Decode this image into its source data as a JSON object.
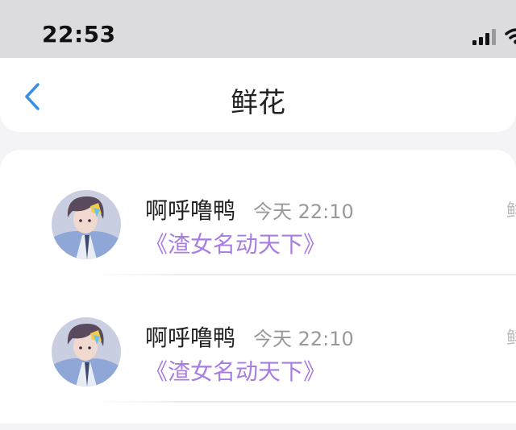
{
  "status_bar": {
    "time": "22:53",
    "signal_icon": "signal-bars-icon",
    "wifi_icon": "wifi-icon"
  },
  "nav": {
    "title": "鲜花",
    "back_icon": "chevron-left-icon",
    "accent_color": "#3a8ee6"
  },
  "messages": [
    {
      "user": "啊呼噜鸭",
      "time": "今天 22:10",
      "text": "《渣女名动天下》",
      "right_hint": "鲜"
    },
    {
      "user": "啊呼噜鸭",
      "time": "今天 22:10",
      "text": "《渣女名动天下》",
      "right_hint": "鲜"
    }
  ],
  "colors": {
    "link": "#a77de0",
    "timestamp": "#999999"
  }
}
